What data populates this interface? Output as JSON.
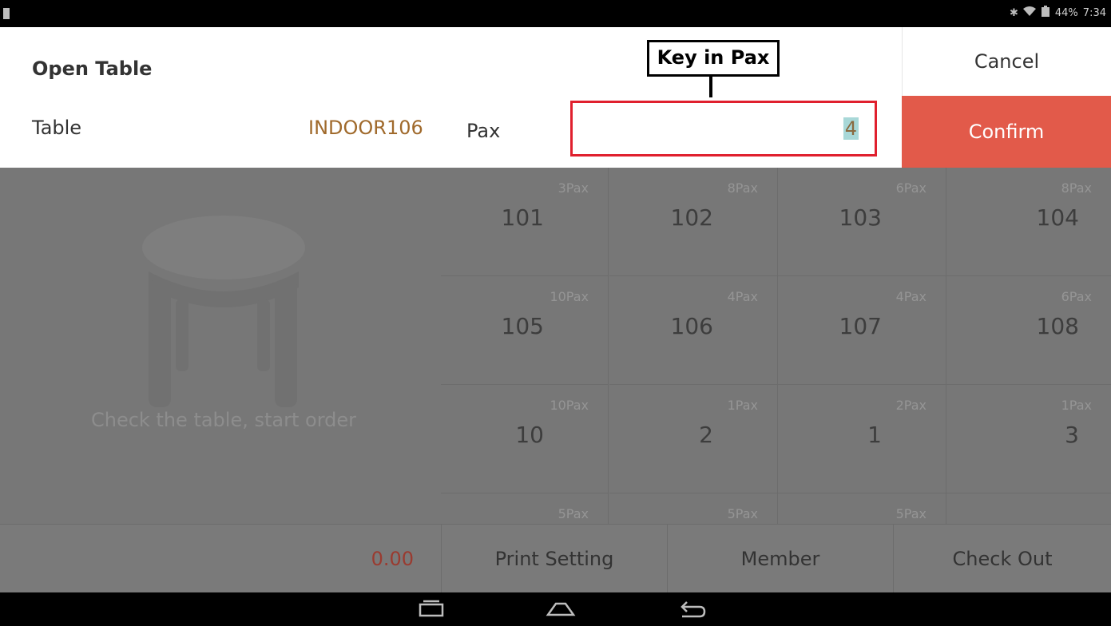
{
  "status_bar": {
    "battery": "44%",
    "time": "7:34",
    "icons": [
      "notification-icon",
      "bluetooth-icon",
      "wifi-icon",
      "battery-icon"
    ]
  },
  "dialog": {
    "title": "Open Table",
    "table_label": "Table",
    "table_value": "INDOOR106",
    "pax_label": "Pax",
    "pax_value": "4",
    "cancel_label": "Cancel",
    "confirm_label": "Confirm",
    "callout": "Key in Pax"
  },
  "left_panel": {
    "message": "Check the table, start order"
  },
  "tables": [
    {
      "number": "101",
      "pax": "3Pax"
    },
    {
      "number": "102",
      "pax": "8Pax"
    },
    {
      "number": "103",
      "pax": "6Pax"
    },
    {
      "number": "104",
      "pax": "8Pax"
    },
    {
      "number": "105",
      "pax": "10Pax"
    },
    {
      "number": "106",
      "pax": "4Pax"
    },
    {
      "number": "107",
      "pax": "4Pax"
    },
    {
      "number": "108",
      "pax": "6Pax"
    },
    {
      "number": "10",
      "pax": "10Pax"
    },
    {
      "number": "2",
      "pax": "1Pax"
    },
    {
      "number": "1",
      "pax": "2Pax"
    },
    {
      "number": "3",
      "pax": "1Pax"
    },
    {
      "number": "",
      "pax": "5Pax"
    },
    {
      "number": "",
      "pax": "5Pax"
    },
    {
      "number": "",
      "pax": "5Pax"
    },
    {
      "number": "",
      "pax": ""
    }
  ],
  "bottom_bar": {
    "total": "0.00",
    "print_setting": "Print Setting",
    "member": "Member",
    "check_out": "Check Out"
  },
  "colors": {
    "accent": "#e25a4a",
    "highlight": "#e0202e",
    "overlay": "#777777"
  }
}
